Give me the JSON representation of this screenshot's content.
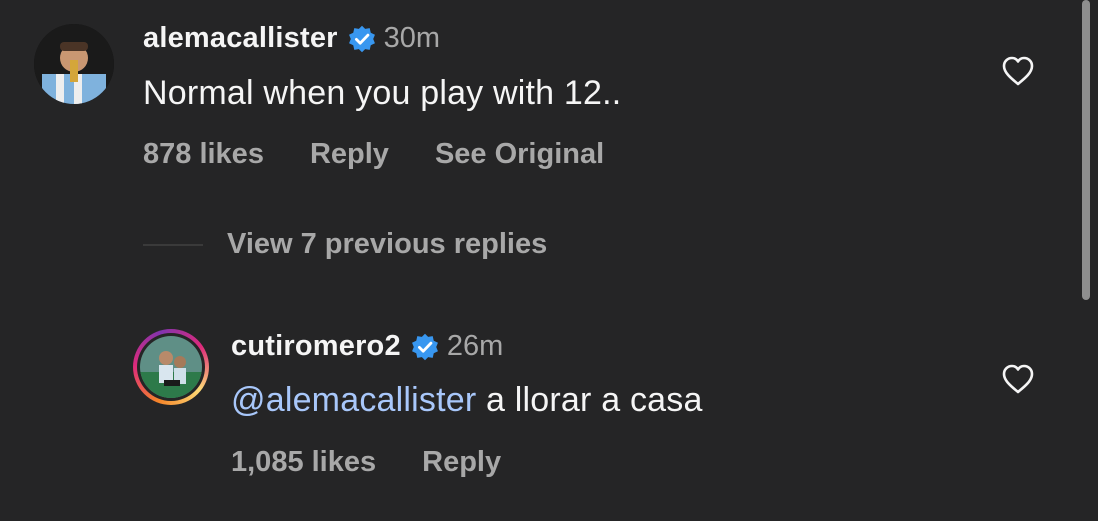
{
  "comments": [
    {
      "username": "alemacallister",
      "time": "30m",
      "text": "Normal when you play with 12..",
      "likes": "878 likes",
      "reply_label": "Reply",
      "see_original_label": "See Original"
    },
    {
      "username": "cutiromero2",
      "time": "26m",
      "mention": "@alemacallister",
      "text": "a llorar a casa",
      "likes": "1,085 likes",
      "reply_label": "Reply"
    }
  ],
  "view_replies_label": "View 7 previous replies",
  "colors": {
    "background": "#252526",
    "verified": "#3897f0",
    "mention": "#a8c7fa",
    "muted": "#a8a8a8"
  }
}
